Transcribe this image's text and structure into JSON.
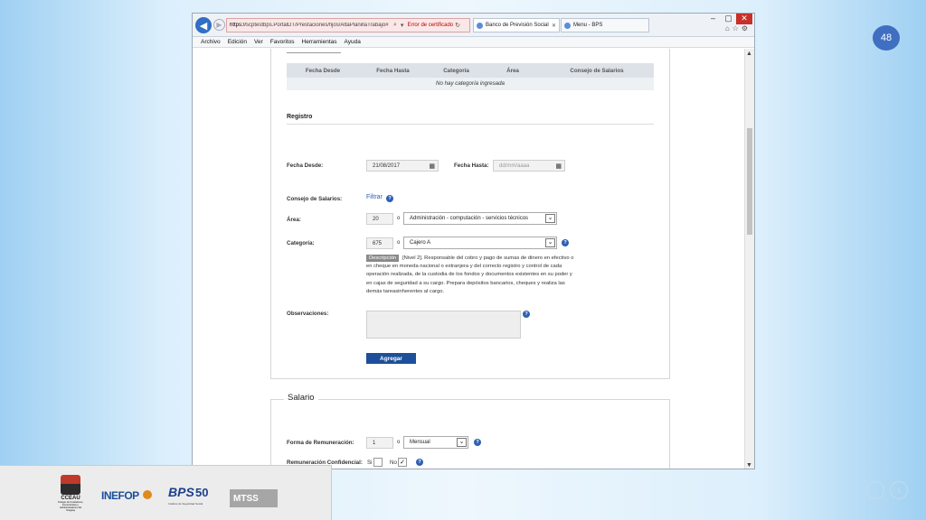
{
  "slide": {
    "number": "48"
  },
  "browser": {
    "url_host": "https://",
    "url_rest": "scptestbps.PortalDT/Prestaciones/fijos/AltaPlanillaTrabajo#",
    "cert_error": "Error de certificado",
    "tabs": [
      {
        "label": "Banco de Previsión Social"
      },
      {
        "label": "Menu - BPS"
      }
    ],
    "menu": [
      "Archivo",
      "Edición",
      "Ver",
      "Favoritos",
      "Herramientas",
      "Ayuda"
    ]
  },
  "categories_table": {
    "headers": [
      "Fecha Desde",
      "Fecha Hasta",
      "Categoría",
      "Área",
      "Consejo de Salarios"
    ],
    "empty_message": "No hay categoría ingresada"
  },
  "registro": {
    "title": "Registro",
    "fecha_desde_label": "Fecha Desde:",
    "fecha_desde_value": "21/08/2017",
    "fecha_hasta_label": "Fecha Hasta:",
    "fecha_hasta_placeholder": "dd/mm/aaaa",
    "consejo_label": "Consejo de Salarios:",
    "filtrar": "Filtrar",
    "area_label": "Área:",
    "area_code": "20",
    "area_sep": "o",
    "area_value": "Administración - computación - servicios técnicos",
    "categoria_label": "Categoría:",
    "categoria_code": "675",
    "categoria_sep": "o",
    "categoria_value": "Cajero A",
    "descripcion_tag": "Descripción",
    "descripcion_text": "[Nivel 2]. Responsable del cobro y pago de sumas de dinero en efectivo o en cheque en moneda nacional o extranjera y del correcto registro y control de cada operación realizada, de la custodia de los fondos y documentos existentes en su poder y en cajas de seguridad a su cargo. Prepara depósitos bancarios, cheques y realiza las demás tareasinherentes al cargo.",
    "observaciones_label": "Observaciones:",
    "agregar": "Agregar"
  },
  "salario": {
    "title": "Salario",
    "forma_label": "Forma de Remuneración:",
    "forma_code": "1",
    "forma_sep": "o",
    "forma_value": "Mensual",
    "confidencial_label": "Remuneración Confidencial:",
    "si": "Si",
    "no": "No",
    "no_checked": "✓"
  },
  "logos": {
    "cceau": "CCEAU",
    "cceau_sub": "Colegio de Contadores, Economistas y Administradores del Uruguay",
    "inefop": "INEFOP",
    "bps": "BPS",
    "bps_50": "50",
    "bps_sub": "Instituto de Seguridad Social",
    "mtss": "MTSS"
  },
  "colors": {
    "accent": "#3f6fc1",
    "button": "#1d4f9a",
    "help": "#2d5fb4"
  }
}
